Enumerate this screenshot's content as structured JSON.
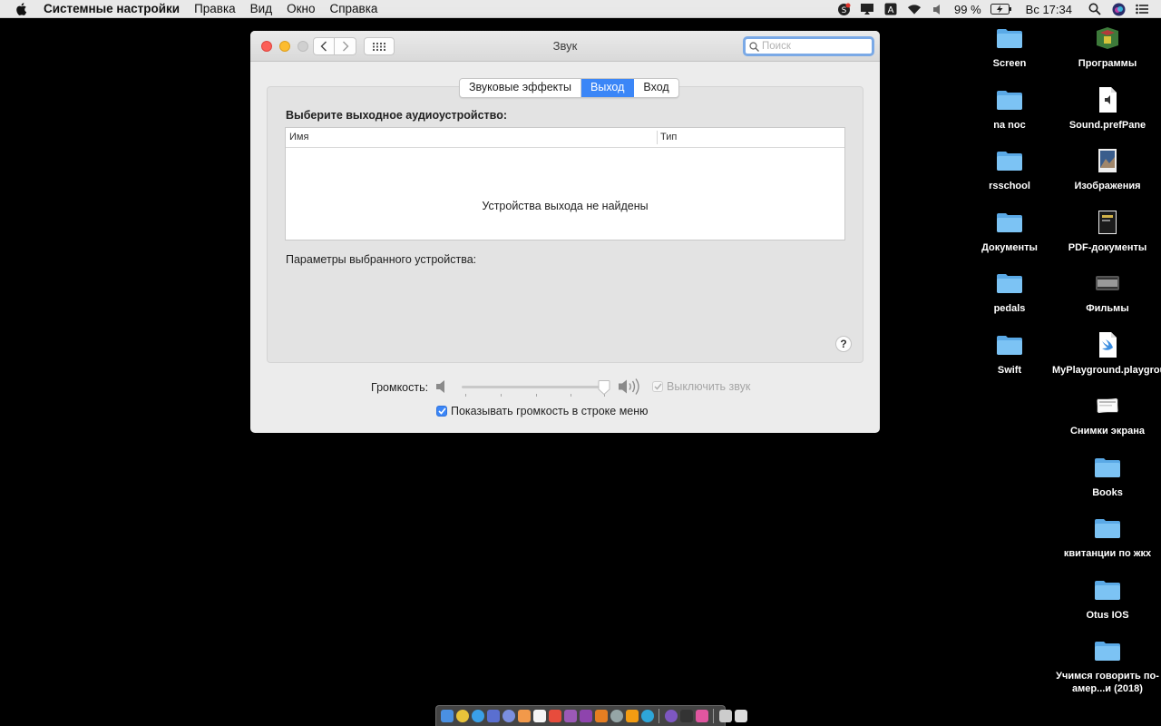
{
  "menubar": {
    "app_name": "Системные настройки",
    "items": [
      "Правка",
      "Вид",
      "Окно",
      "Справка"
    ],
    "battery": "99 %",
    "clock": "Вс 17:34",
    "status_icons": [
      "skype-icon",
      "screen-mirror-icon",
      "input-source-icon",
      "wifi-icon",
      "volume-icon",
      "battery-icon",
      "spotlight-icon",
      "siri-icon",
      "notification-center-icon"
    ]
  },
  "window": {
    "title": "Звук",
    "search_placeholder": "Поиск",
    "tabs": [
      {
        "label": "Звуковые эффекты",
        "active": false
      },
      {
        "label": "Выход",
        "active": true
      },
      {
        "label": "Вход",
        "active": false
      }
    ],
    "section_label": "Выберите выходное аудиоустройство:",
    "table": {
      "col_name": "Имя",
      "col_type": "Тип",
      "empty_message": "Устройства выхода не найдены"
    },
    "params_label": "Параметры выбранного устройства:",
    "help_label": "?",
    "volume_label": "Громкость:",
    "volume_level": 0.98,
    "mute_label": "Выключить звук",
    "mute_checked": true,
    "mute_disabled": true,
    "show_volume_label": "Показывать громкость в строке меню",
    "show_volume_checked": true
  },
  "desktop": {
    "left_column": [
      {
        "label": "Screen",
        "icon": "folder-icon"
      },
      {
        "label": "na noc",
        "icon": "folder-icon"
      },
      {
        "label": "rsschool",
        "icon": "folder-icon"
      },
      {
        "label": "Документы",
        "icon": "folder-icon"
      },
      {
        "label": "pedals",
        "icon": "folder-icon"
      },
      {
        "label": "Swift",
        "icon": "folder-icon"
      }
    ],
    "right_column": [
      {
        "label": "Программы",
        "icon": "applications-icon"
      },
      {
        "label": "Sound.prefPane",
        "icon": "document-icon"
      },
      {
        "label": "Изображения",
        "icon": "image-icon"
      },
      {
        "label": "PDF-документы",
        "icon": "pdf-icon"
      },
      {
        "label": "Фильмы",
        "icon": "movies-icon"
      },
      {
        "label": "MyPlayground.playground",
        "icon": "swift-file-icon"
      },
      {
        "label": "Снимки экрана",
        "icon": "screenshots-icon"
      },
      {
        "label": "Books",
        "icon": "folder-icon"
      },
      {
        "label": "квитанции по жкх",
        "icon": "folder-icon"
      },
      {
        "label": "Otus IOS",
        "icon": "folder-icon"
      },
      {
        "label": "Учимся говорить по-амер...и (2018)",
        "icon": "folder-icon"
      }
    ]
  },
  "colors": {
    "accent": "#3b86f7",
    "folder": "#6fb9ee",
    "desktop": "#000000"
  }
}
